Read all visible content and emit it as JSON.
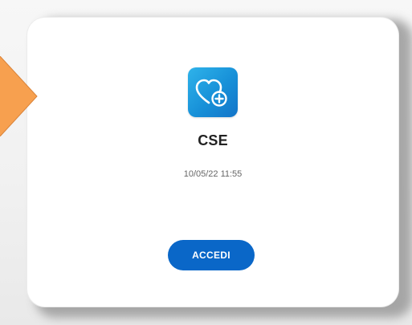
{
  "card": {
    "app_name": "CSE",
    "last_access": "10/05/22 11:55",
    "button_label": "ACCEDI",
    "icon": "heart-plus-icon"
  },
  "colors": {
    "button": "#0a67c8",
    "icon_gradient_start": "#2fb3ea",
    "icon_gradient_end": "#1474c8",
    "pointer_arrow": "#f7a04f"
  }
}
